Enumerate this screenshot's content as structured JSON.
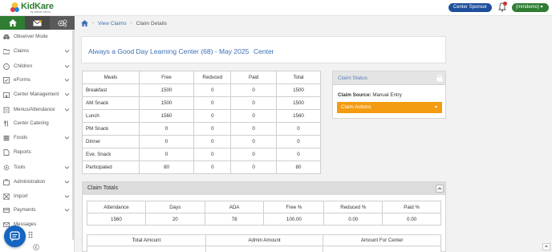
{
  "app": {
    "logo_text": "KidKare",
    "logo_sub": "by Minute Menu"
  },
  "header": {
    "sponsor_button": "Center Sponsor",
    "user_button": "(mmdemo) ▾"
  },
  "sidebar": {
    "items": [
      {
        "label": "Observer Mode",
        "icon": "binoculars-icon",
        "has_chevron": false
      },
      {
        "label": "Claims",
        "icon": "folder-icon",
        "has_chevron": true
      },
      {
        "label": "Children",
        "icon": "child-icon",
        "has_chevron": true
      },
      {
        "label": "eForms",
        "icon": "checkbox-icon",
        "has_chevron": true
      },
      {
        "label": "Center Management",
        "icon": "building-icon",
        "has_chevron": true
      },
      {
        "label": "Menus/Attendance",
        "icon": "clipboard-icon",
        "has_chevron": true
      },
      {
        "label": "Center Catering",
        "icon": "utensils-icon",
        "has_chevron": false
      },
      {
        "label": "Foods",
        "icon": "food-icon",
        "has_chevron": true
      },
      {
        "label": "Reports",
        "icon": "report-icon",
        "has_chevron": false
      },
      {
        "label": "Tools",
        "icon": "gear-icon",
        "has_chevron": true
      },
      {
        "label": "Administration",
        "icon": "admin-icon",
        "has_chevron": true
      },
      {
        "label": "Import",
        "icon": "import-icon",
        "has_chevron": true
      },
      {
        "label": "Payments",
        "icon": "card-icon",
        "has_chevron": true
      },
      {
        "label": "Messages",
        "icon": "envelope-icon",
        "has_chevron": false
      }
    ]
  },
  "breadcrumb": {
    "link": "View Claims",
    "current": "Claim Details"
  },
  "claim": {
    "title": "Always a Good Day Learning Center (68) - May 2025",
    "type": "Center"
  },
  "meals_table": {
    "headers": [
      "Meals",
      "Free",
      "Reduced",
      "Paid",
      "Total"
    ],
    "rows": [
      [
        "Breakfast",
        "1500",
        "0",
        "0",
        "1500"
      ],
      [
        "AM Snack",
        "1500",
        "0",
        "0",
        "1500"
      ],
      [
        "Lunch",
        "1560",
        "0",
        "0",
        "1560"
      ],
      [
        "PM Snack",
        "0",
        "0",
        "0",
        "0"
      ],
      [
        "Dinner",
        "0",
        "0",
        "0",
        "0"
      ],
      [
        "Eve. Snack",
        "0",
        "0",
        "0",
        "0"
      ],
      [
        "Participated",
        "80",
        "0",
        "0",
        "80"
      ]
    ]
  },
  "claim_status": {
    "heading": "Claim Status",
    "source_label": "Claim Source:",
    "source_value": "Manual Entry",
    "actions_label": "Claim Actions",
    "actions_caret": "▾"
  },
  "claim_totals": {
    "heading": "Claim Totals",
    "stats_headers": [
      "Attendance",
      "Days",
      "ADA",
      "Free %",
      "Reduced %",
      "Paid %"
    ],
    "stats_values": [
      "1560",
      "20",
      "78",
      "100.00",
      "0.00",
      "0.00"
    ],
    "amount_headers": [
      "Total Amount",
      "Admin Amount",
      "Amount For Center"
    ]
  },
  "colors": {
    "brand_green": "#2e7d32",
    "sponsor_blue": "#1f4f9c",
    "link_blue": "#3b6fb6",
    "actions_orange": "#f39c12"
  }
}
